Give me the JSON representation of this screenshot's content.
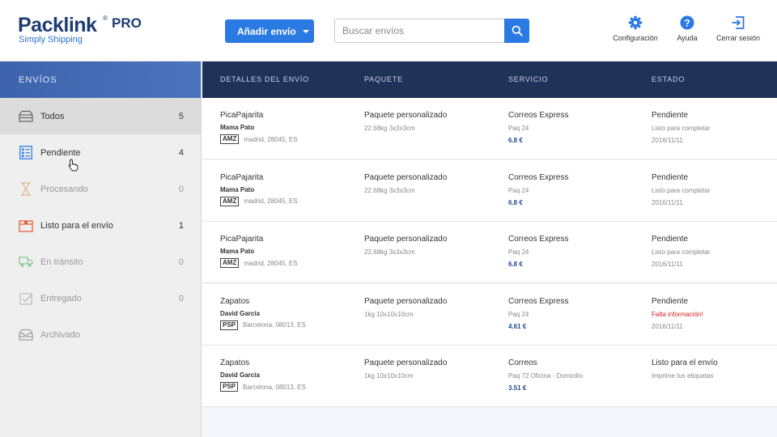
{
  "brand": {
    "name": "Packlink",
    "reg": "®",
    "pro": "PRO",
    "tagline": "Simply Shipping"
  },
  "toolbar": {
    "add_label": "Añadir envío",
    "search_placeholder": "Buscar envíos",
    "config_label": "Configuración",
    "help_label": "Ayuda",
    "logout_label": "Cerrar sesión"
  },
  "sidebar": {
    "header": "ENVÍOS",
    "items": [
      {
        "label": "Todos",
        "count": "5",
        "icon": "tray-icon"
      },
      {
        "label": "Pendiente",
        "count": "4",
        "icon": "checklist-icon"
      },
      {
        "label": "Procesando",
        "count": "0",
        "icon": "hourglass-icon"
      },
      {
        "label": "Listo para el envío",
        "count": "1",
        "icon": "box-icon"
      },
      {
        "label": "En tránsito",
        "count": "0",
        "icon": "truck-icon"
      },
      {
        "label": "Entregado",
        "count": "0",
        "icon": "delivered-check-icon"
      },
      {
        "label": "Archivado",
        "count": "",
        "icon": "archive-icon"
      }
    ]
  },
  "table": {
    "headers": [
      "DETALLES DEL ENVÍO",
      "PAQUETE",
      "SERVICIO",
      "ESTADO"
    ],
    "rows": [
      {
        "title": "PicaPajarita",
        "name": "Mama Pato",
        "tag": "AMZ",
        "address": "madrid, 28045, ES",
        "package": "Paquete personalizado",
        "dims": "22.68kg 3x3x3cm",
        "service": "Correos Express",
        "service_detail": "Paq 24",
        "price": "6.8 €",
        "status": "Pendiente",
        "status_detail": "Listo para completar",
        "date": "2016/11/11"
      },
      {
        "title": "PicaPajarita",
        "name": "Mama Pato",
        "tag": "AMZ",
        "address": "madrid, 28045, ES",
        "package": "Paquete personalizado",
        "dims": "22.68kg 3x3x3cm",
        "service": "Correos Express",
        "service_detail": "Paq 24",
        "price": "6.8 €",
        "status": "Pendiente",
        "status_detail": "Listo para completar",
        "date": "2016/11/11"
      },
      {
        "title": "PicaPajarita",
        "name": "Mama Pato",
        "tag": "AMZ",
        "address": "madrid, 28045, ES",
        "package": "Paquete personalizado",
        "dims": "22.68kg 3x3x3cm",
        "service": "Correos Express",
        "service_detail": "Paq 24",
        "price": "6.8 €",
        "status": "Pendiente",
        "status_detail": "Listo para completar",
        "date": "2016/11/11"
      },
      {
        "title": "Zapatos",
        "name": "David García",
        "tag": "PSP",
        "address": "Barcelona, 08013, ES",
        "package": "Paquete personalizado",
        "dims": "1kg 10x10x10cm",
        "service": "Correos Express",
        "service_detail": "Paq 24",
        "price": "4.61 €",
        "status": "Pendiente",
        "status_detail": "Falta información!",
        "date": "2016/11/11"
      },
      {
        "title": "Zapatos",
        "name": "David García",
        "tag": "PSP",
        "address": "Barcelona, 08013, ES",
        "package": "Paquete personalizado",
        "dims": "1kg 10x10x10cm",
        "service": "Correos",
        "service_detail": "Paq 72 Oficina - Domicilio",
        "price": "3.51 €",
        "status": "Listo para el envío",
        "status_detail": "Imprime tus etiquetas",
        "date": ""
      }
    ]
  },
  "colors": {
    "primary": "#2b7ae4",
    "header": "#203257",
    "sidebar_header": "#4069b4",
    "warning": "#d01f1f",
    "price": "#1f4a8f"
  }
}
